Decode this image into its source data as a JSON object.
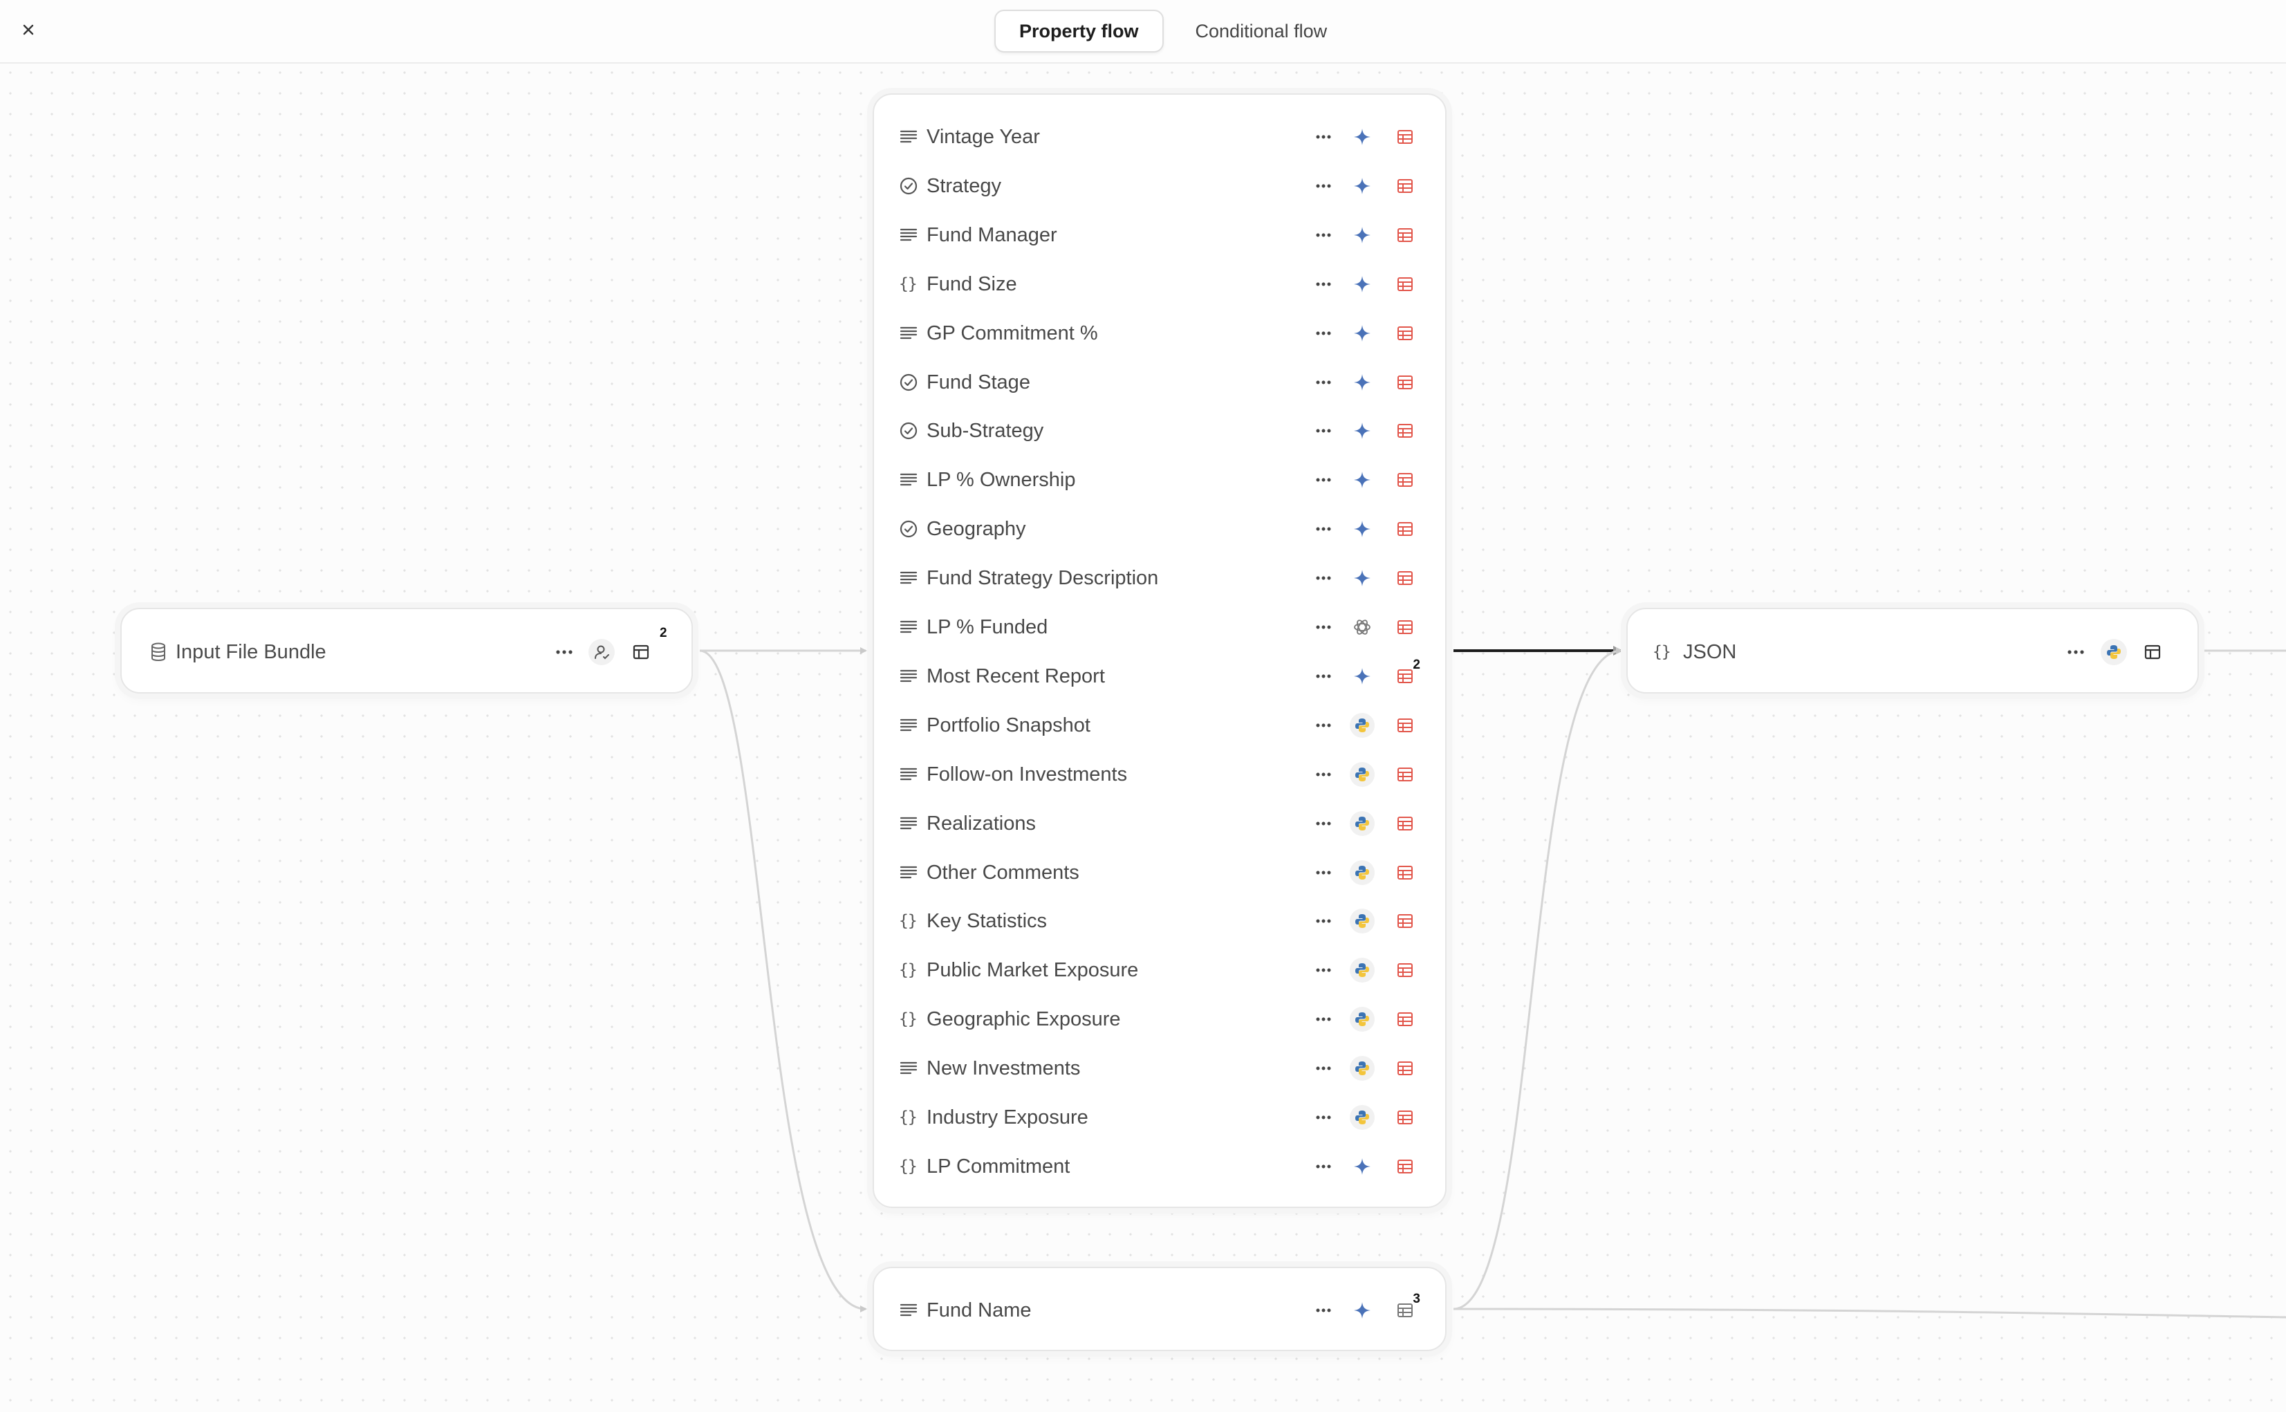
{
  "tabs": [
    {
      "label": "Property flow",
      "active": true
    },
    {
      "label": "Conditional flow",
      "active": false
    }
  ],
  "colors": {
    "sparkle": "#4a72b8",
    "table_red": "#e2564b",
    "python_blue": "#3b73b3",
    "python_yellow": "#f3c53c",
    "edge": "#d0d0d0",
    "edge_active": "#1c1c1c"
  },
  "input_node": {
    "label": "Input File Bundle",
    "icon": "database-icon",
    "badge": "2",
    "actions": [
      "more-icon",
      "user-icon",
      "table-icon"
    ]
  },
  "json_node": {
    "label": "JSON",
    "icon": "braces-icon",
    "actions": [
      "more-icon",
      "python-icon",
      "table-icon"
    ]
  },
  "properties": [
    {
      "label": "Vintage Year",
      "type": "text",
      "method": "ai"
    },
    {
      "label": "Strategy",
      "type": "select",
      "method": "ai"
    },
    {
      "label": "Fund Manager",
      "type": "text",
      "method": "ai"
    },
    {
      "label": "Fund Size",
      "type": "json",
      "method": "ai"
    },
    {
      "label": "GP Commitment %",
      "type": "text",
      "method": "ai"
    },
    {
      "label": "Fund Stage",
      "type": "select",
      "method": "ai"
    },
    {
      "label": "Sub-Strategy",
      "type": "select",
      "method": "ai"
    },
    {
      "label": "LP % Ownership",
      "type": "text",
      "method": "ai"
    },
    {
      "label": "Geography",
      "type": "select",
      "method": "ai"
    },
    {
      "label": "Fund Strategy Description",
      "type": "text",
      "method": "ai"
    },
    {
      "label": "LP % Funded",
      "type": "text",
      "method": "openai"
    },
    {
      "label": "Most Recent Report",
      "type": "text",
      "method": "ai",
      "badge": "2"
    },
    {
      "label": "Portfolio Snapshot",
      "type": "text",
      "method": "python"
    },
    {
      "label": "Follow-on Investments",
      "type": "text",
      "method": "python"
    },
    {
      "label": "Realizations",
      "type": "text",
      "method": "python"
    },
    {
      "label": "Other Comments",
      "type": "text",
      "method": "python"
    },
    {
      "label": "Key Statistics",
      "type": "json",
      "method": "python"
    },
    {
      "label": "Public Market Exposure",
      "type": "json",
      "method": "python"
    },
    {
      "label": "Geographic Exposure",
      "type": "json",
      "method": "python"
    },
    {
      "label": "New Investments",
      "type": "text",
      "method": "python"
    },
    {
      "label": "Industry Exposure",
      "type": "json",
      "method": "python"
    },
    {
      "label": "LP Commitment",
      "type": "json",
      "method": "ai"
    }
  ],
  "fund_name_node": {
    "label": "Fund Name",
    "type": "text",
    "method": "ai",
    "badge": "3"
  }
}
